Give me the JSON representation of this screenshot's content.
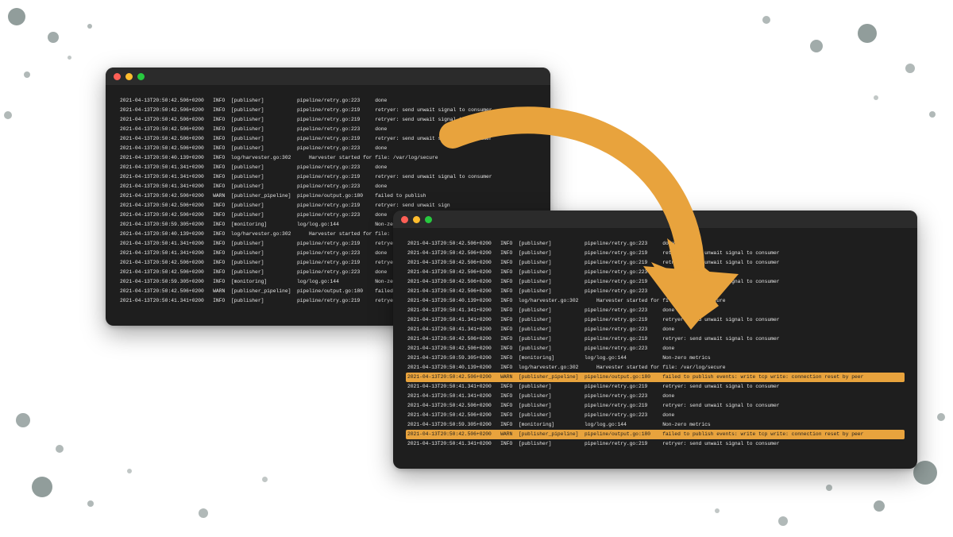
{
  "arrow_color": "#e8a33d",
  "terminal_left": {
    "lines": [
      {
        "ts": "2021-04-13T20:50:42.506+0200",
        "lvl": "INFO",
        "mod": "[publisher]",
        "loc": "pipeline/retry.go:223",
        "msg": "done"
      },
      {
        "ts": "2021-04-13T20:50:42.506+0200",
        "lvl": "INFO",
        "mod": "[publisher]",
        "loc": "pipeline/retry.go:219",
        "msg": "retryer: send unwait signal to consumer"
      },
      {
        "ts": "2021-04-13T20:50:42.506+0200",
        "lvl": "INFO",
        "mod": "[publisher]",
        "loc": "pipeline/retry.go:219",
        "msg": "retryer: send unwait signal to consumer"
      },
      {
        "ts": "2021-04-13T20:50:42.506+0200",
        "lvl": "INFO",
        "mod": "[publisher]",
        "loc": "pipeline/retry.go:223",
        "msg": "done"
      },
      {
        "ts": "2021-04-13T20:50:42.506+0200",
        "lvl": "INFO",
        "mod": "[publisher]",
        "loc": "pipeline/retry.go:219",
        "msg": "retryer: send unwait signal to consumer"
      },
      {
        "ts": "2021-04-13T20:50:42.506+0200",
        "lvl": "INFO",
        "mod": "[publisher]",
        "loc": "pipeline/retry.go:223",
        "msg": "done"
      },
      {
        "ts": "2021-04-13T20:50:40.139+0200",
        "lvl": "INFO",
        "mod": "",
        "loc": "log/harvester.go:302",
        "msg": "Harvester started for file: /var/log/secure"
      },
      {
        "ts": "2021-04-13T20:50:41.341+0200",
        "lvl": "INFO",
        "mod": "[publisher]",
        "loc": "pipeline/retry.go:223",
        "msg": "done"
      },
      {
        "ts": "2021-04-13T20:50:41.341+0200",
        "lvl": "INFO",
        "mod": "[publisher]",
        "loc": "pipeline/retry.go:219",
        "msg": "retryer: send unwait signal to consumer"
      },
      {
        "ts": "2021-04-13T20:50:41.341+0200",
        "lvl": "INFO",
        "mod": "[publisher]",
        "loc": "pipeline/retry.go:223",
        "msg": "done"
      },
      {
        "ts": "2021-04-13T20:50:42.506+0200",
        "lvl": "WARN",
        "mod": "[publisher_pipeline]",
        "loc": "pipeline/output.go:180",
        "msg": "failed to publish"
      },
      {
        "ts": "2021-04-13T20:50:42.506+0200",
        "lvl": "INFO",
        "mod": "[publisher]",
        "loc": "pipeline/retry.go:219",
        "msg": "retryer: send unwait sign"
      },
      {
        "ts": "2021-04-13T20:50:42.506+0200",
        "lvl": "INFO",
        "mod": "[publisher]",
        "loc": "pipeline/retry.go:223",
        "msg": "done"
      },
      {
        "ts": "2021-04-13T20:50:59.305+0200",
        "lvl": "INFO",
        "mod": "[monitoring]",
        "loc": "log/log.go:144",
        "msg": "Non-zero metrics"
      },
      {
        "ts": "2021-04-13T20:50:40.139+0200",
        "lvl": "INFO",
        "mod": "",
        "loc": "log/harvester.go:302",
        "msg": "Harvester started for file: /var/log/secu"
      },
      {
        "ts": "2021-04-13T20:50:41.341+0200",
        "lvl": "INFO",
        "mod": "[publisher]",
        "loc": "pipeline/retry.go:219",
        "msg": "retryer: send unwait sign"
      },
      {
        "ts": "2021-04-13T20:50:41.341+0200",
        "lvl": "INFO",
        "mod": "[publisher]",
        "loc": "pipeline/retry.go:223",
        "msg": "done"
      },
      {
        "ts": "2021-04-13T20:50:42.506+0200",
        "lvl": "INFO",
        "mod": "[publisher]",
        "loc": "pipeline/retry.go:219",
        "msg": "retryer: send unwait sign"
      },
      {
        "ts": "2021-04-13T20:50:42.506+0200",
        "lvl": "INFO",
        "mod": "[publisher]",
        "loc": "pipeline/retry.go:223",
        "msg": "done"
      },
      {
        "ts": "2021-04-13T20:50:59.305+0200",
        "lvl": "INFO",
        "mod": "[monitoring]",
        "loc": "log/log.go:144",
        "msg": "Non-zero metrics"
      },
      {
        "ts": "2021-04-13T20:50:42.506+0200",
        "lvl": "WARN",
        "mod": "[publisher_pipeline]",
        "loc": "pipeline/output.go:180",
        "msg": "failed to publish"
      },
      {
        "ts": "2021-04-13T20:50:41.341+0200",
        "lvl": "INFO",
        "mod": "[publisher]",
        "loc": "pipeline/retry.go:219",
        "msg": "retryer: send unwait sign"
      }
    ]
  },
  "terminal_right": {
    "lines": [
      {
        "ts": "2021-04-13T20:50:42.506+0200",
        "lvl": "INFO",
        "mod": "[publisher]",
        "loc": "pipeline/retry.go:223",
        "msg": "done"
      },
      {
        "ts": "2021-04-13T20:50:42.506+0200",
        "lvl": "INFO",
        "mod": "[publisher]",
        "loc": "pipeline/retry.go:219",
        "msg": "retryer: send unwait signal to consumer"
      },
      {
        "ts": "2021-04-13T20:50:42.506+0200",
        "lvl": "INFO",
        "mod": "[publisher]",
        "loc": "pipeline/retry.go:219",
        "msg": "retryer: send unwait signal to consumer"
      },
      {
        "ts": "2021-04-13T20:50:42.506+0200",
        "lvl": "INFO",
        "mod": "[publisher]",
        "loc": "pipeline/retry.go:223",
        "msg": "done"
      },
      {
        "ts": "2021-04-13T20:50:42.506+0200",
        "lvl": "INFO",
        "mod": "[publisher]",
        "loc": "pipeline/retry.go:219",
        "msg": "retryer: send unwait signal to consumer"
      },
      {
        "ts": "2021-04-13T20:50:42.506+0200",
        "lvl": "INFO",
        "mod": "[publisher]",
        "loc": "pipeline/retry.go:223",
        "msg": "done"
      },
      {
        "ts": "2021-04-13T20:50:40.139+0200",
        "lvl": "INFO",
        "mod": "",
        "loc": "log/harvester.go:302",
        "msg": "Harvester started for file: /var/log/secure"
      },
      {
        "ts": "2021-04-13T20:50:41.341+0200",
        "lvl": "INFO",
        "mod": "[publisher]",
        "loc": "pipeline/retry.go:223",
        "msg": "done"
      },
      {
        "ts": "2021-04-13T20:50:41.341+0200",
        "lvl": "INFO",
        "mod": "[publisher]",
        "loc": "pipeline/retry.go:219",
        "msg": "retryer: send unwait signal to consumer"
      },
      {
        "ts": "2021-04-13T20:50:41.341+0200",
        "lvl": "INFO",
        "mod": "[publisher]",
        "loc": "pipeline/retry.go:223",
        "msg": "done"
      },
      {
        "ts": "2021-04-13T20:50:42.506+0200",
        "lvl": "INFO",
        "mod": "[publisher]",
        "loc": "pipeline/retry.go:219",
        "msg": "retryer: send unwait signal to consumer"
      },
      {
        "ts": "2021-04-13T20:50:42.506+0200",
        "lvl": "INFO",
        "mod": "[publisher]",
        "loc": "pipeline/retry.go:223",
        "msg": "done"
      },
      {
        "ts": "2021-04-13T20:50:59.305+0200",
        "lvl": "INFO",
        "mod": "[monitoring]",
        "loc": "log/log.go:144",
        "msg": "Non-zero metrics"
      },
      {
        "ts": "2021-04-13T20:50:40.139+0200",
        "lvl": "INFO",
        "mod": "",
        "loc": "log/harvester.go:302",
        "msg": "Harvester started for file: /var/log/secure"
      },
      {
        "ts": "2021-04-13T20:50:42.506+0200",
        "lvl": "WARN",
        "mod": "[publisher_pipeline]",
        "loc": "pipeline/output.go:180",
        "msg": "failed to publish events: write tcp write: connection reset by peer",
        "hl": true
      },
      {
        "ts": "2021-04-13T20:50:41.341+0200",
        "lvl": "INFO",
        "mod": "[publisher]",
        "loc": "pipeline/retry.go:219",
        "msg": "retryer: send unwait signal to consumer"
      },
      {
        "ts": "2021-04-13T20:50:41.341+0200",
        "lvl": "INFO",
        "mod": "[publisher]",
        "loc": "pipeline/retry.go:223",
        "msg": "done"
      },
      {
        "ts": "2021-04-13T20:50:42.506+0200",
        "lvl": "INFO",
        "mod": "[publisher]",
        "loc": "pipeline/retry.go:219",
        "msg": "retryer: send unwait signal to consumer"
      },
      {
        "ts": "2021-04-13T20:50:42.506+0200",
        "lvl": "INFO",
        "mod": "[publisher]",
        "loc": "pipeline/retry.go:223",
        "msg": "done"
      },
      {
        "ts": "2021-04-13T20:50:59.305+0200",
        "lvl": "INFO",
        "mod": "[monitoring]",
        "loc": "log/log.go:144",
        "msg": "Non-zero metrics"
      },
      {
        "ts": "2021-04-13T20:50:42.506+0200",
        "lvl": "WARN",
        "mod": "[publisher_pipeline]",
        "loc": "pipeline/output.go:180",
        "msg": "failed to publish events: write tcp write: connection reset by peer",
        "hl": true
      },
      {
        "ts": "2021-04-13T20:50:41.341+0200",
        "lvl": "INFO",
        "mod": "[publisher]",
        "loc": "pipeline/retry.go:219",
        "msg": "retryer: send unwait signal to consumer"
      }
    ]
  }
}
